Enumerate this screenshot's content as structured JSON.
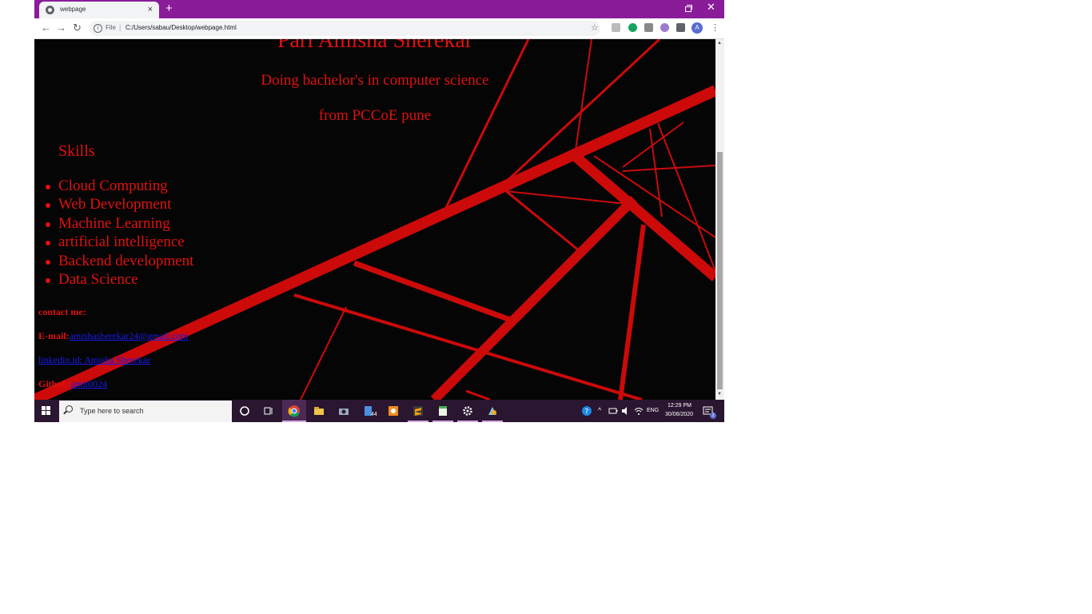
{
  "browser": {
    "tab_title": "webpage",
    "tab_close": "×",
    "new_tab": "+",
    "window_close": "✕",
    "nav_back": "←",
    "nav_forward": "→",
    "nav_reload": "↻",
    "url_scheme_label": "File",
    "url_separator": "|",
    "url": "C:/Users/sabau/Desktop/webpage.html",
    "star": "☆",
    "menu": "⋮",
    "avatar_letter": "A",
    "accent_color": "#8a1c9a",
    "extension_icons": [
      "np-extension-icon",
      "grammarly-icon",
      "cart-icon",
      "vpn-icon",
      "puzzle-extensions-icon"
    ]
  },
  "page": {
    "heading": "Pari Amisha Sherekar",
    "line1": "Doing bachelor's in computer science",
    "line2": "from PCCoE pune",
    "skills_heading": "Skills",
    "skills": [
      "Cloud Computing",
      "Web Development",
      "Machine Learning",
      "artificial intelligence",
      "Backend development",
      "Data Science"
    ],
    "contact_title": "contact me:",
    "email_label": "E-mail:",
    "email_link": "amishasherekar24@gmail.com",
    "linkedin_link": "linkedin.id: Amisha Sherekar",
    "github_label": "Github:",
    "github_link": "amit0024",
    "text_color": "#e01010",
    "background_color": "#050505",
    "web_line_color": "#cc0a0a",
    "link_color": "#1a1aee"
  },
  "taskbar": {
    "search_placeholder": "Type here to search",
    "mail_badge": "44",
    "language": "ENG",
    "time": "12:29 PM",
    "date": "30/06/2020",
    "notification_count": "2",
    "pinned_apps": [
      "cortana-icon",
      "task-view-icon",
      "chrome-icon",
      "file-explorer-icon",
      "camera-icon",
      "mail-icon",
      "paint-icon",
      "sublime-icon",
      "notepad-icon",
      "settings-icon",
      "paint3d-icon"
    ]
  }
}
